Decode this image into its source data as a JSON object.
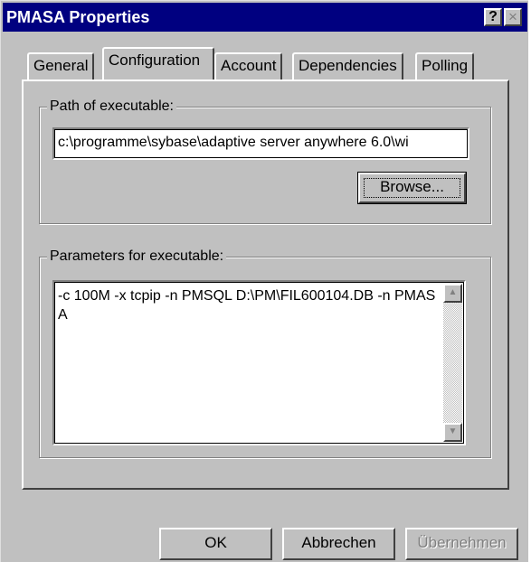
{
  "window": {
    "title": "PMASA Properties",
    "help_button": "?",
    "close_button": "×"
  },
  "tabs": [
    {
      "label": "General",
      "active": false
    },
    {
      "label": "Configuration",
      "active": true
    },
    {
      "label": "Account",
      "active": false
    },
    {
      "label": "Dependencies",
      "active": false
    },
    {
      "label": "Polling",
      "active": false
    }
  ],
  "path_group": {
    "label": "Path of executable:",
    "value": "c:\\programme\\sybase\\adaptive server anywhere 6.0\\wi",
    "browse_label": "Browse..."
  },
  "params_group": {
    "label": "Parameters for executable:",
    "value": "-c 100M -x tcpip -n PMSQL D:\\PM\\FIL600104.DB -n PMASA"
  },
  "footer": {
    "ok_label": "OK",
    "cancel_label": "Abbrechen",
    "apply_label": "Übernehmen"
  },
  "colors": {
    "titlebar": "#000080",
    "face": "#c0c0c0"
  }
}
